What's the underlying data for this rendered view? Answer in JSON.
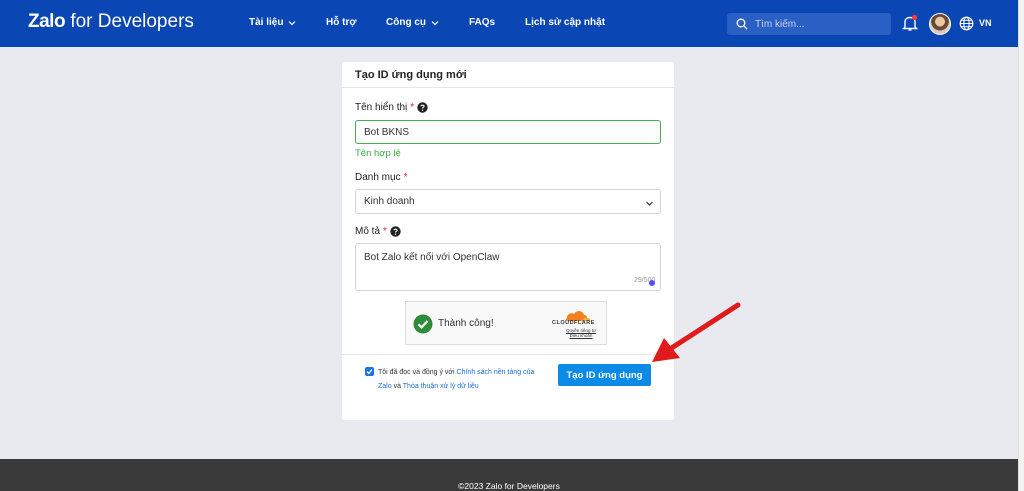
{
  "header": {
    "brand_bold": "Zalo",
    "brand_rest": " for Developers",
    "nav": [
      {
        "label": "Tài liệu",
        "dropdown": true
      },
      {
        "label": "Hỗ trợ",
        "dropdown": false
      },
      {
        "label": "Công cụ",
        "dropdown": true
      },
      {
        "label": "FAQs",
        "dropdown": false
      },
      {
        "label": "Lịch sử cập nhật",
        "dropdown": false
      }
    ],
    "search_placeholder": "Tìm kiếm...",
    "language": "VN"
  },
  "form": {
    "title": "Tạo ID ứng dụng mới",
    "display_name_label": "Tên hiển thị",
    "required_mark": "*",
    "display_name_value": "Bot BKNS",
    "display_name_valid": "Tên hợp lệ",
    "category_label": "Danh mục",
    "category_value": "Kinh doanh",
    "description_label": "Mô tả",
    "description_value": "Bot Zalo kết nối với OpenClaw",
    "description_counter": "29/500",
    "captcha_status": "Thành công!",
    "captcha_brand": "CLOUDFLARE",
    "captcha_links": "Quyền riêng tư Điều khoản",
    "agree_prefix": "Tôi đã đọc và đồng ý với ",
    "agree_link1": "Chính sách nền tảng của Zalo",
    "agree_and": " và ",
    "agree_link2": "Thỏa thuận xử lý dữ liệu",
    "agree_checked": true,
    "submit_label": "Tạo ID ứng dụng"
  },
  "footer": {
    "copyright": "©2023 Zalo for Developers"
  },
  "colors": {
    "header_bg": "#0a46b4",
    "primary_button": "#0b8be5",
    "valid_green": "#3aa843",
    "annotation_arrow": "#e01b1b"
  }
}
